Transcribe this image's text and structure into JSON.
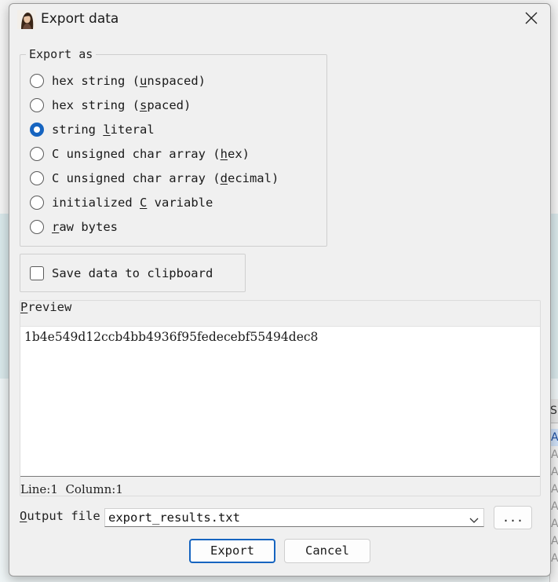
{
  "dialog": {
    "title": "Export data",
    "app_icon": "portrait-icon",
    "close_icon": "close-icon"
  },
  "export_as": {
    "label": "Export as",
    "selected": "string literal",
    "options": [
      {
        "pre": "hex string (",
        "key": "u",
        "post": "nspaced)",
        "checked": false
      },
      {
        "pre": "hex string (",
        "key": "s",
        "post": "paced)",
        "checked": false
      },
      {
        "pre": "string ",
        "key": "l",
        "post": "iteral",
        "checked": true
      },
      {
        "pre": "C unsigned char array (",
        "key": "h",
        "post": "ex)",
        "checked": false
      },
      {
        "pre": "C unsigned char array (",
        "key": "d",
        "post": "ecimal)",
        "checked": false
      },
      {
        "pre": "initialized ",
        "key": "C",
        "post": " variable",
        "checked": false
      },
      {
        "pre": "",
        "key": "r",
        "post": "aw bytes",
        "checked": false
      }
    ]
  },
  "clipboard": {
    "label": "Save data to clipboard",
    "checked": false
  },
  "preview": {
    "label_key": "P",
    "label_rest": "review",
    "text": "1b4e549d12ccb4bb4936f95fedecebf55494dec8"
  },
  "status": {
    "line_label": "Line:",
    "line": "1",
    "column_label": "Column:",
    "column": "1"
  },
  "output": {
    "label_key": "O",
    "label_rest": "utput file",
    "value": "export_results.txt",
    "browse_label": "..."
  },
  "buttons": {
    "export": "Export",
    "cancel": "Cancel"
  },
  "background": {
    "header_fragment": "S",
    "cell_fragment": "AF"
  },
  "colors": {
    "accent": "#1664c0",
    "dialog_bg": "#f0f0f0"
  }
}
